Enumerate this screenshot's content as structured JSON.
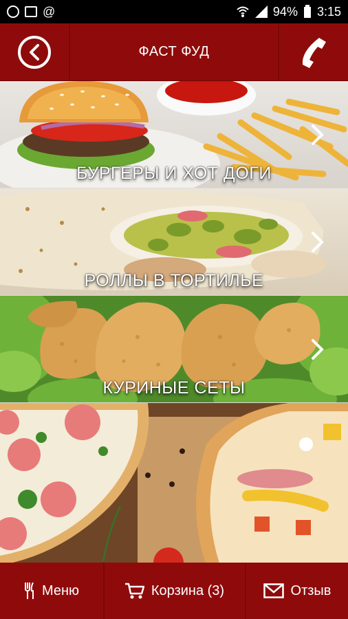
{
  "status_bar": {
    "battery": "94%",
    "time": "3:15"
  },
  "header": {
    "title": "ФАСТ ФУД"
  },
  "categories": [
    {
      "label": "БУРГЕРЫ И ХОТ ДОГИ"
    },
    {
      "label": "РОЛЛЫ В ТОРТИЛЬЕ"
    },
    {
      "label": "КУРИНЫЕ СЕТЫ"
    },
    {
      "label": ""
    }
  ],
  "bottom_nav": {
    "menu_label": "Меню",
    "cart_label": "Корзина (3)",
    "feedback_label": "Отзыв"
  },
  "colors": {
    "brand_red": "#8f0b0b"
  }
}
